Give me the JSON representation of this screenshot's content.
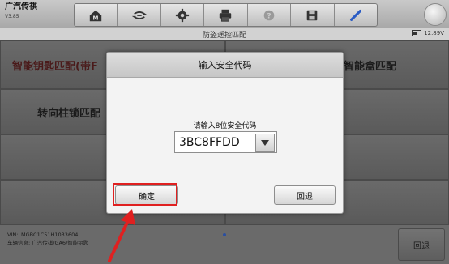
{
  "app": {
    "brand": "广汽传祺",
    "version": "V3.85"
  },
  "toolbar": {
    "icons": [
      "home-icon",
      "vehicle-swap-icon",
      "settings-icon",
      "print-icon",
      "help-icon",
      "save-icon",
      "pen-icon"
    ]
  },
  "title_strip": {
    "title": "防盗遥控匹配",
    "battery": "12.89V"
  },
  "menu": {
    "items": [
      {
        "label": "智能钥匙匹配(带F"
      },
      {
        "label": "智能盒匹配"
      },
      {
        "label": "转向柱锁匹配"
      }
    ]
  },
  "footer": {
    "vin": "VIN:LMGBC1C51H1033604",
    "vehicle_info": "车辆信息: 广汽传祺/GA6/智能钥匙",
    "back_label": "回退"
  },
  "dialog": {
    "title": "输入安全代码",
    "prompt": "请输入8位安全代码",
    "code_value": "3BC8FFDD",
    "confirm_label": "确定",
    "back_label": "回退"
  },
  "colors": {
    "highlight": "#e02020",
    "accent": "#2a4fa0"
  }
}
